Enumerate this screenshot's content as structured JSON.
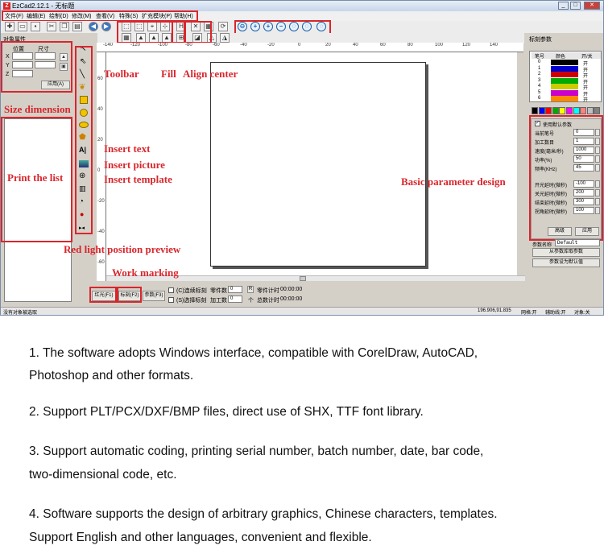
{
  "window": {
    "title": "EzCad2.12.1 - 无标题",
    "logo": "Z"
  },
  "menu": [
    "文件(F)",
    "编辑(E)",
    "绘制(D)",
    "修改(M)",
    "查看(V)",
    "特殊(S)",
    "扩充模块(P)",
    "帮助(H)"
  ],
  "left_panel": {
    "title": "对象属性",
    "pos_label": "位置",
    "size_label": "尺寸",
    "axis_x": "X",
    "axis_y": "Y",
    "axis_z": "Z",
    "apply_button": "应用(A)"
  },
  "ruler": {
    "top_ticks": [
      "-140",
      "-120",
      "-100",
      "-80",
      "-60",
      "-40",
      "-20",
      "0",
      "20",
      "40",
      "60",
      "80",
      "100",
      "120",
      "140"
    ],
    "left_ticks": [
      "60",
      "40",
      "20",
      "0",
      "-20",
      "-40",
      "-60"
    ]
  },
  "right_panel": {
    "title": "标刻参数",
    "pen_headers": [
      "笔号",
      "颜色",
      "开/关"
    ],
    "pens": [
      {
        "no": "0",
        "color": "#000000",
        "state": "开"
      },
      {
        "no": "1",
        "color": "#0000cc",
        "state": "开"
      },
      {
        "no": "2",
        "color": "#cc0000",
        "state": "开"
      },
      {
        "no": "3",
        "color": "#00aa00",
        "state": "开"
      },
      {
        "no": "4",
        "color": "#cccc00",
        "state": "开"
      },
      {
        "no": "5",
        "color": "#cc00cc",
        "state": "开"
      },
      {
        "no": "6",
        "color": "#ff8800",
        "state": "开"
      }
    ],
    "palette": [
      "#000000",
      "#0000ff",
      "#ff0000",
      "#00aa00",
      "#ffff00",
      "#ff00ff",
      "#00ffff",
      "#ff8080",
      "#c0c0c0",
      "#808080"
    ],
    "use_default": "使用默认参数",
    "params": [
      {
        "label": "当前笔号",
        "value": "0"
      },
      {
        "label": "加工数目",
        "value": "1"
      },
      {
        "label": "速度(毫米/秒)",
        "value": "1000"
      },
      {
        "label": "功率(%)",
        "value": "50"
      },
      {
        "label": "频率(KHz)",
        "value": "45"
      }
    ],
    "delays": [
      {
        "label": "开光延时(微秒)",
        "value": "-100"
      },
      {
        "label": "关光延时(微秒)",
        "value": "200"
      },
      {
        "label": "结束延时(微秒)",
        "value": "300"
      },
      {
        "label": "拐角延时(微秒)",
        "value": "100"
      }
    ],
    "advanced_button": "高级",
    "apply_button": "应用",
    "param_name_label": "参数名称",
    "param_name_value": "Default",
    "load_button": "从参数库取参数",
    "set_default_button": "参数设为默认值"
  },
  "bottom": {
    "red_light": "红光(F1)",
    "mark": "标刻(F2)",
    "params": "参数(F3)",
    "continuous": "(C)连续标刻",
    "parts_label": "零件数",
    "parts_value": "0",
    "r_button": "R",
    "part_timer": "零件计时",
    "part_time": "00:00:00",
    "selected": "(S)选择标刻",
    "process_label": "加工数",
    "process_value": "0",
    "unit": "个",
    "total_timer": "总数计时",
    "total_time": "00:00:00"
  },
  "status": {
    "left": "没有对象被选取",
    "coords": "196.906,91.835",
    "grid": "网格:开",
    "guide": "辅助线:开",
    "object": "对象:关"
  },
  "annotations": {
    "toolbar": "Toolbar",
    "fill": "Fill",
    "align": "Align center",
    "size_dimension": "Size dimension",
    "print_list": "Print the list",
    "insert_text": "Insert text",
    "insert_picture": "Insert picture",
    "insert_template": "Insert template",
    "basic_param": "Basic parameter design",
    "red_light": "Red light position preview",
    "work_marking": "Work marking"
  },
  "features": [
    "1. The software adopts Windows interface, compatible with CorelDraw, AutoCAD,",
    "Photoshop and other formats.",
    "2. Support PLT/PCX/DXF/BMP files, direct use of SHX, TTF font library.",
    "3. Support automatic coding, printing serial number, batch number, date, bar code,",
    " two-dimensional code, etc.",
    "4. Software supports the design of arbitrary graphics, Chinese characters, templates.",
    "Support English and other languages, convenient and flexible."
  ]
}
